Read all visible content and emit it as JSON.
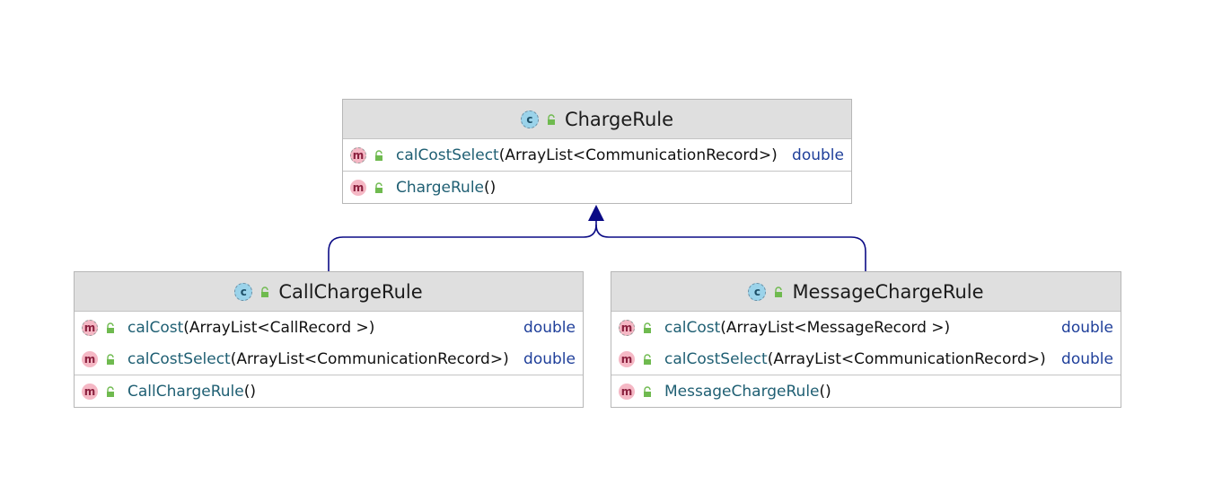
{
  "colors": {
    "header_bg": "#dfdfdf",
    "border": "#b7b7b7",
    "method_name": "#1f5f73",
    "return_type": "#1f3f9a",
    "edge": "#0b0b85",
    "method_icon": "#f5b8c5",
    "class_icon": "#9bd3ea",
    "public_lock": "#6fba4f"
  },
  "classes": {
    "charge_rule": {
      "icon": "class-icon",
      "icon_letter": "c",
      "name": "ChargeRule",
      "methods": [
        {
          "icon": "abstract-method-icon",
          "icon_letter": "m",
          "name": "calCostSelect",
          "params": "(ArrayList<CommunicationRecord>)",
          "returns": "double"
        }
      ],
      "constructors": [
        {
          "icon": "method-icon",
          "icon_letter": "m",
          "name": "ChargeRule",
          "params": "()"
        }
      ]
    },
    "call_charge_rule": {
      "icon": "class-icon",
      "icon_letter": "c",
      "name": "CallChargeRule",
      "methods": [
        {
          "icon": "abstract-method-icon",
          "icon_letter": "m",
          "name": "calCost",
          "params": "(ArrayList<CallRecord >)",
          "returns": "double"
        },
        {
          "icon": "method-icon",
          "icon_letter": "m",
          "name": "calCostSelect",
          "params": "(ArrayList<CommunicationRecord>)",
          "returns": "double"
        }
      ],
      "constructors": [
        {
          "icon": "method-icon",
          "icon_letter": "m",
          "name": "CallChargeRule",
          "params": "()"
        }
      ]
    },
    "message_charge_rule": {
      "icon": "class-icon",
      "icon_letter": "c",
      "name": "MessageChargeRule",
      "methods": [
        {
          "icon": "abstract-method-icon",
          "icon_letter": "m",
          "name": "calCost",
          "params": "(ArrayList<MessageRecord >)",
          "returns": "double"
        },
        {
          "icon": "method-icon",
          "icon_letter": "m",
          "name": "calCostSelect",
          "params": "(ArrayList<CommunicationRecord>)",
          "returns": "double"
        }
      ],
      "constructors": [
        {
          "icon": "method-icon",
          "icon_letter": "m",
          "name": "MessageChargeRule",
          "params": " ()"
        }
      ]
    }
  },
  "relations": [
    {
      "type": "generalization",
      "from": "call_charge_rule",
      "to": "charge_rule"
    },
    {
      "type": "generalization",
      "from": "message_charge_rule",
      "to": "charge_rule"
    }
  ]
}
